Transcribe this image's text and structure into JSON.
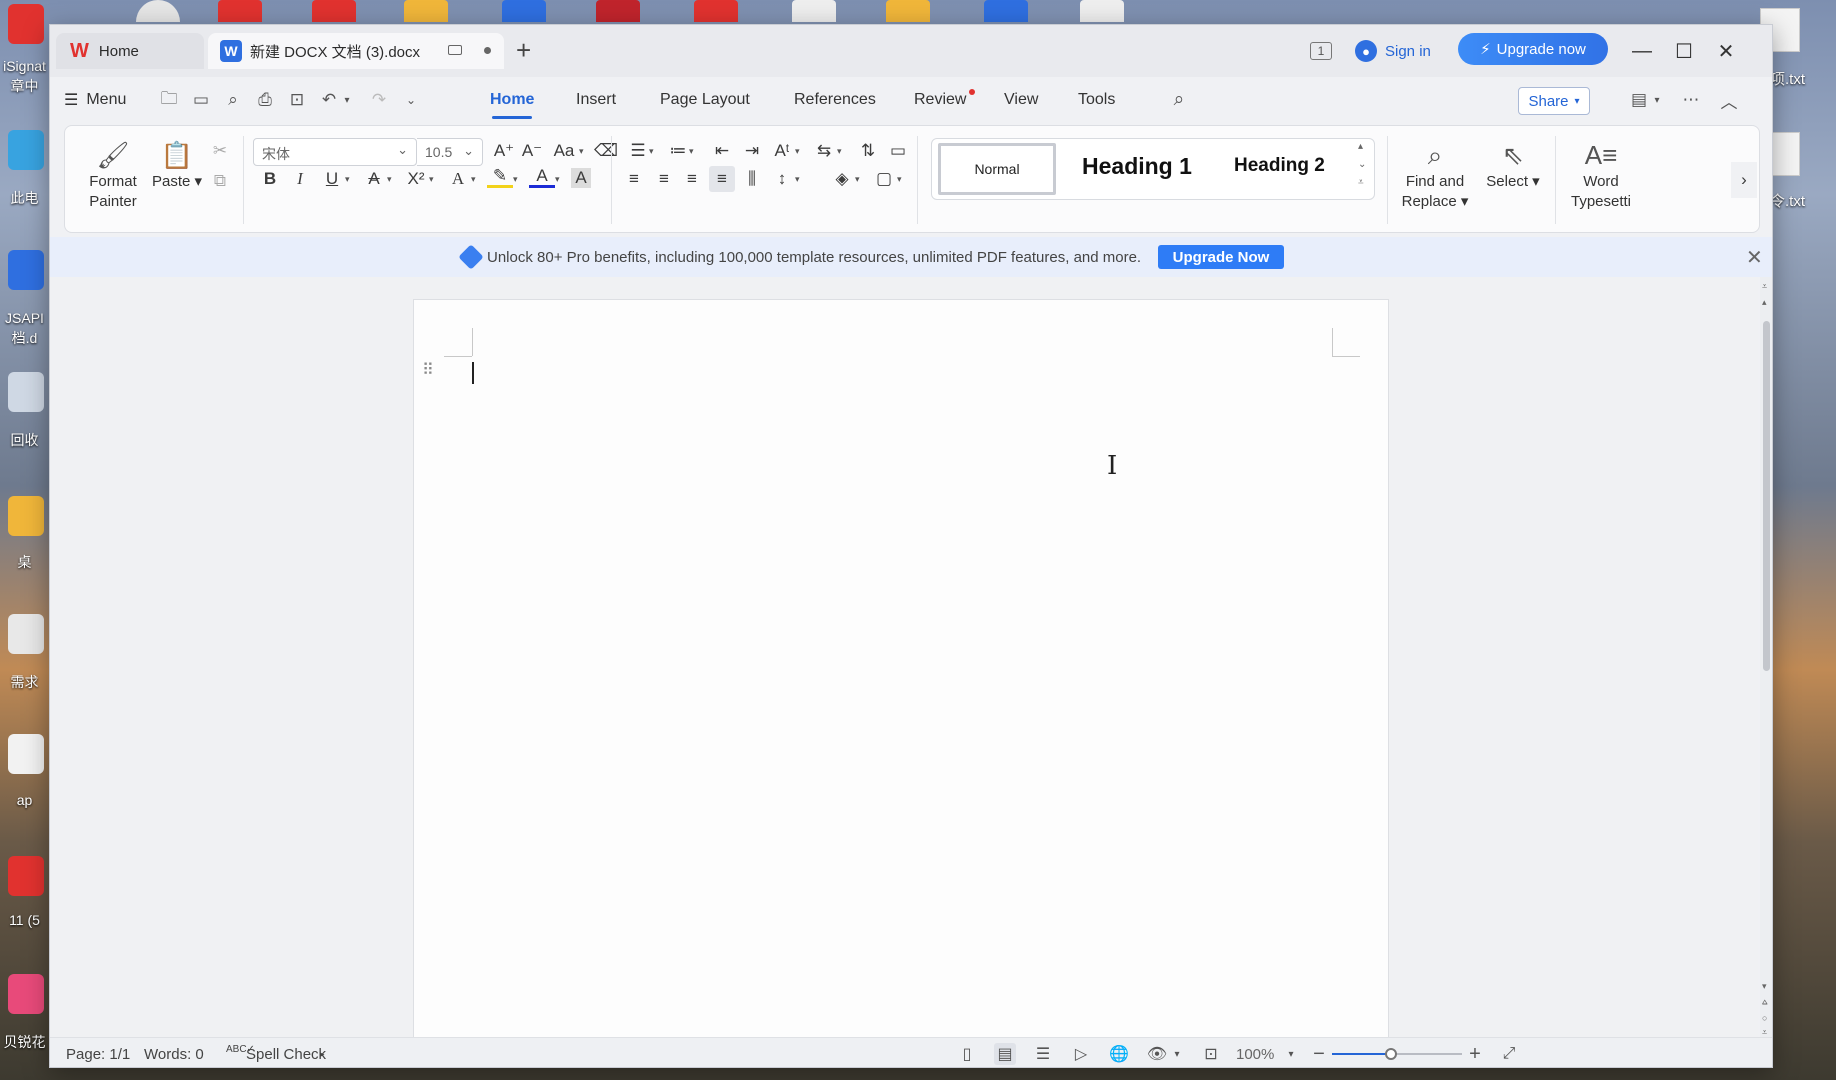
{
  "desktop": {
    "left_labels": [
      "iSignat",
      "章中",
      "此电",
      "JSAPI",
      "档.d",
      "回收",
      "桌",
      "需求",
      "ap",
      "11 (5",
      "贝锐花"
    ],
    "right_labels": [
      "项.txt",
      "令.txt"
    ]
  },
  "titlebar": {
    "home_tab": "Home",
    "doc_tab": "新建 DOCX 文档 (3).docx",
    "new_tab": "+",
    "page_count_badge": "1",
    "sign_in": "Sign in",
    "upgrade": "Upgrade now",
    "minimize": "—",
    "maximize": "☐",
    "close": "✕"
  },
  "menubar": {
    "menu": "Menu",
    "tabs": [
      "Home",
      "Insert",
      "Page Layout",
      "References",
      "Review",
      "View",
      "Tools"
    ],
    "active_tab": "Home",
    "share": "Share"
  },
  "ribbon": {
    "format_painter": [
      "Format",
      "Painter"
    ],
    "paste": "Paste",
    "font_name": "宋体",
    "font_size": "10.5",
    "styles": [
      "Normal",
      "Heading 1",
      "Heading 2"
    ],
    "find_replace": [
      "Find and",
      "Replace"
    ],
    "select": "Select",
    "word_typesetting": [
      "Word",
      "Typesetti"
    ]
  },
  "promo": {
    "text": "Unlock 80+ Pro benefits, including 100,000 template resources, unlimited PDF features, and more.",
    "button": "Upgrade Now"
  },
  "statusbar": {
    "page": "Page: 1/1",
    "words": "Words: 0",
    "spell_check": "Spell Check",
    "zoom": "100%",
    "zoom_level": 0.45
  },
  "colors": {
    "accent": "#2465d6",
    "upgrade": "#3172e6",
    "wps_red": "#e1322f"
  }
}
